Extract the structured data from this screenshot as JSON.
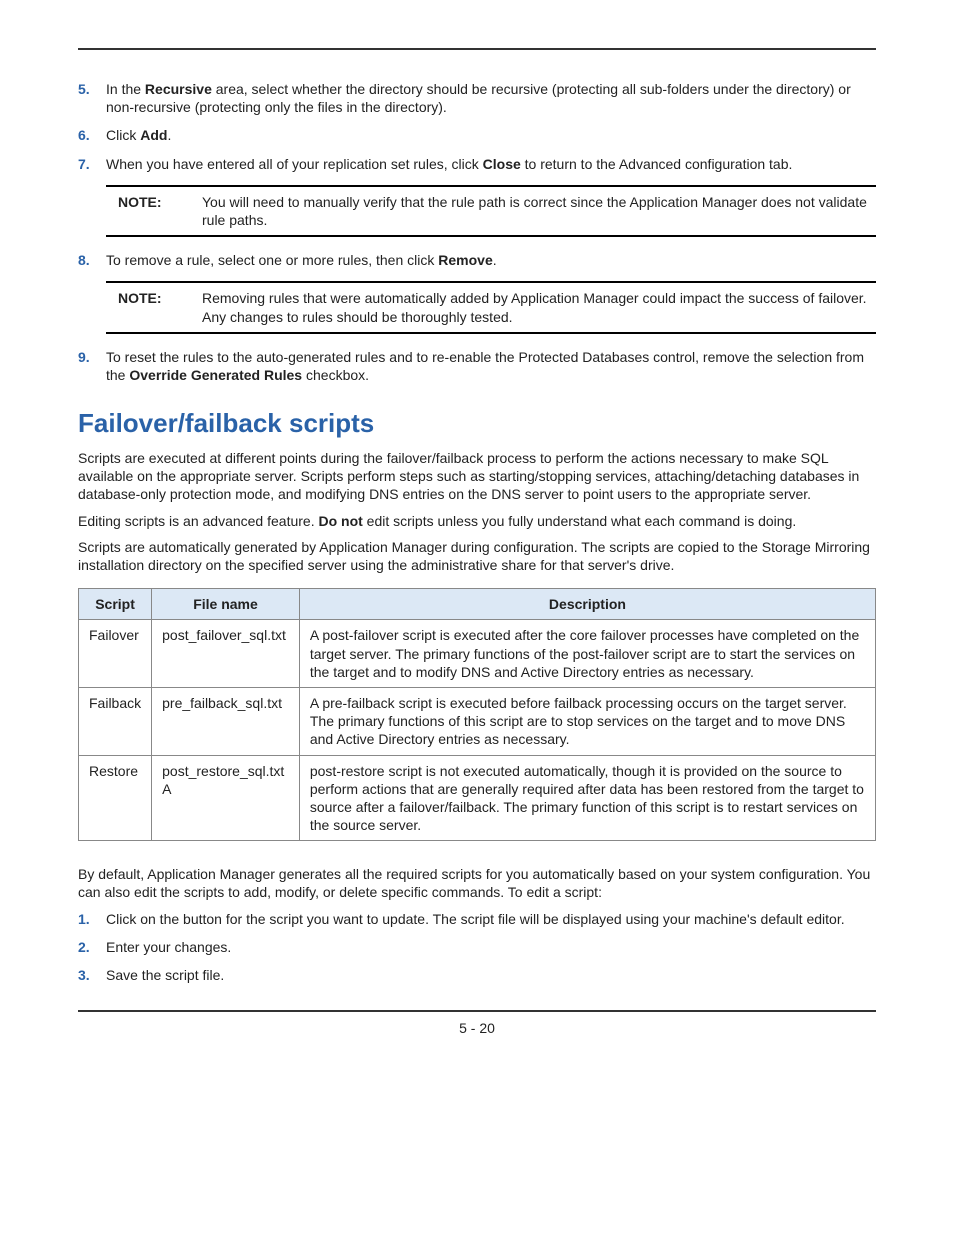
{
  "steps_a": [
    {
      "num": "5.",
      "html": "In the <b>Recursive</b> area, select whether the directory should be recursive (protecting all sub-folders under the directory) or non-recursive (protecting only the files in the directory)."
    },
    {
      "num": "6.",
      "html": "Click <b>Add</b>."
    },
    {
      "num": "7.",
      "html": "When you have entered all of your replication set rules, click <b>Close</b> to return to the Advanced configuration tab."
    }
  ],
  "note1": {
    "label": "NOTE:",
    "text": "You will need to manually verify that the rule path is correct since the Application Manager does not validate rule paths."
  },
  "steps_b": [
    {
      "num": "8.",
      "html": "To remove a rule, select one or more rules, then click <b>Remove</b>."
    }
  ],
  "note2": {
    "label": "NOTE:",
    "text": "Removing rules that were automatically added by Application Manager could impact the success of failover. Any changes to rules should be thoroughly tested."
  },
  "steps_c": [
    {
      "num": "9.",
      "html": "To reset the rules to the auto-generated rules and to re-enable the Protected Databases control, remove the selection from the <b>Override Generated Rules</b> checkbox."
    }
  ],
  "section_heading": "Failover/failback scripts",
  "paras": [
    "Scripts are executed at different points during the failover/failback process to perform the actions necessary to make SQL available on the appropriate server. Scripts perform steps such as starting/stopping services, attaching/detaching databases in database-only protection mode, and modifying DNS entries on the DNS server to point users to the appropriate server.",
    "Editing scripts is an advanced feature. <b>Do not</b> edit scripts unless you fully understand what each command is doing.",
    "Scripts are automatically generated by Application Manager during configuration. The scripts are copied to the Storage Mirroring installation directory on the specified server using the administrative share for that server's drive."
  ],
  "table": {
    "headers": [
      "Script",
      "File name",
      "Description"
    ],
    "rows": [
      {
        "c0": "Failover",
        "c1": "post_failover_sql.txt",
        "c2": "A post-failover script is executed after the core failover processes have completed on the target server. The primary functions of the post-failover script are to start the services on the target and to modify DNS and Active Directory entries as necessary."
      },
      {
        "c0": "Failback",
        "c1": "pre_failback_sql.txt",
        "c2": "A pre-failback script is executed before failback processing occurs on the target server. The primary functions of this script are to stop services on the target and to move DNS and Active Directory entries as necessary."
      },
      {
        "c0": "Restore",
        "c1": "post_restore_sql.txt A",
        "c2": " post-restore script is not executed automatically, though it is provided on the source to perform actions that are generally required after data has been restored from the target to source after a failover/failback. The primary function of this script is to restart services on the source server."
      }
    ]
  },
  "post_para": "By default, Application Manager generates all the required scripts for you automatically based on your system configuration. You can also edit the scripts to add, modify, or delete specific commands. To edit a script:",
  "steps_d": [
    {
      "num": "1.",
      "html": "Click on the button for the script you want to update. The script file will be displayed using your machine's default editor."
    },
    {
      "num": "2.",
      "html": "Enter your changes."
    },
    {
      "num": "3.",
      "html": "Save the script file."
    }
  ],
  "page_number": "5 - 20"
}
